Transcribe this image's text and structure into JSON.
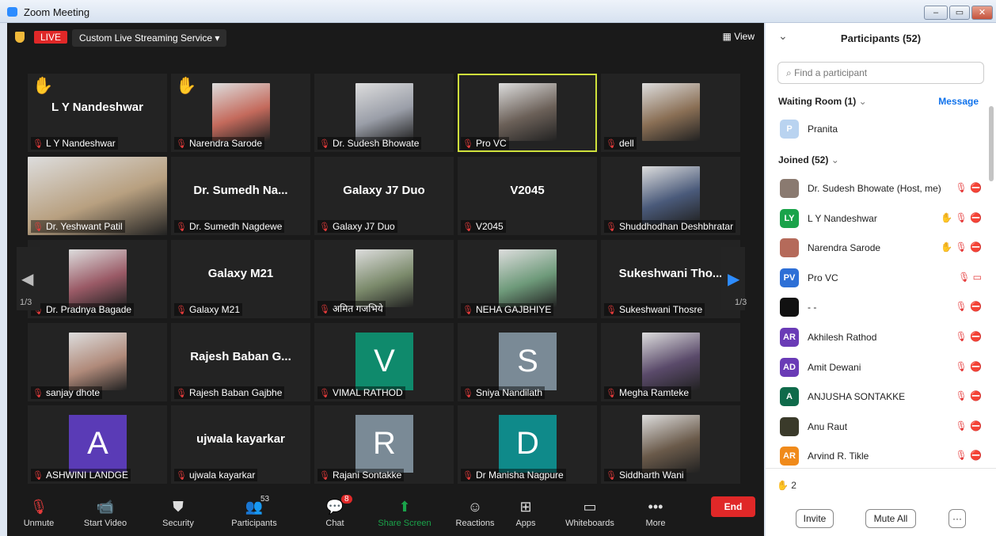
{
  "window": {
    "title": "Zoom Meeting",
    "min": "–",
    "restore": "▭",
    "close": "✕"
  },
  "topbar": {
    "live": "LIVE",
    "service": "Custom Live Streaming Service",
    "service_caret": "▾",
    "view": "View",
    "view_icon": "▦"
  },
  "tiles": [
    {
      "title": "L Y Nandeshwar",
      "label": "L Y Nandeshwar",
      "hand": "✋"
    },
    {
      "title": "",
      "label": "Narendra Sarode",
      "hand": "✋",
      "photo": "#c46a5c"
    },
    {
      "title": "",
      "label": "Dr. Sudesh Bhowate",
      "photo": "#9a9ea8"
    },
    {
      "title": "",
      "label": "Pro VC",
      "photo": "#6b6058",
      "speaking": true
    },
    {
      "title": "",
      "label": "dell",
      "photo": "#8a6f55"
    },
    {
      "title": "",
      "label": "Dr. Yeshwant Patil",
      "photo": "#b8a080"
    },
    {
      "title": "Dr. Sumedh Na...",
      "label": "Dr. Sumedh Nagdewe"
    },
    {
      "title": "Galaxy J7 Duo",
      "label": "Galaxy J7 Duo"
    },
    {
      "title": "V2045",
      "label": "V2045"
    },
    {
      "title": "",
      "label": "Shuddhodhan Deshbhratar",
      "photo": "#4a5a7a"
    },
    {
      "title": "",
      "label": "Dr. Pradnya Bagade",
      "photo": "#9a5a66"
    },
    {
      "title": "Galaxy M21",
      "label": "Galaxy M21"
    },
    {
      "title": "",
      "label": "अमित गजभिये",
      "photo": "#7b8a6b"
    },
    {
      "title": "",
      "label": "NEHA GAJBHIYE",
      "photo": "#6e9a7a"
    },
    {
      "title": "Sukeshwani Tho...",
      "label": "Sukeshwani Thosre"
    },
    {
      "title": "",
      "label": "sanjay dhote",
      "photo": "#b08a7a"
    },
    {
      "title": "Rajesh Baban G...",
      "label": "Rajesh Baban Gajbhe"
    },
    {
      "title": "",
      "label": "VIMAL RATHOD",
      "letter": "V",
      "color": "#0f8a6c"
    },
    {
      "title": "",
      "label": "Sniya Nandilath",
      "letter": "S",
      "color": "#7a8a96"
    },
    {
      "title": "",
      "label": "Megha Ramteke",
      "photo": "#5a4a6a"
    },
    {
      "title": "",
      "label": "ASHWINI LANDGE",
      "letter": "A",
      "color": "#5a3bb6"
    },
    {
      "title": "ujwala kayarkar",
      "label": "ujwala kayarkar"
    },
    {
      "title": "",
      "label": "Rajani Sontakke",
      "letter": "R",
      "color": "#7a8a96"
    },
    {
      "title": "",
      "label": "Dr Manisha Nagpure",
      "letter": "D",
      "color": "#0f8a8a"
    },
    {
      "title": "",
      "label": "Siddharth Wani",
      "photo": "#6a5a4a"
    }
  ],
  "nav": {
    "left": "◀",
    "right": "▶",
    "page_left": "1/3",
    "page_right": "1/3"
  },
  "toolbar": [
    {
      "name": "unmute",
      "icon": "🎙",
      "label": "Unmute"
    },
    {
      "name": "start-video",
      "icon": "📹",
      "label": "Start Video"
    },
    {
      "name": "security",
      "icon": "⛊",
      "label": "Security"
    },
    {
      "name": "participants",
      "icon": "👥",
      "label": "Participants",
      "badge": "53"
    },
    {
      "name": "chat",
      "icon": "💬",
      "label": "Chat",
      "badge": "8"
    },
    {
      "name": "share-screen",
      "icon": "⬆",
      "label": "Share Screen"
    },
    {
      "name": "reactions",
      "icon": "☺",
      "label": "Reactions"
    },
    {
      "name": "apps",
      "icon": "⊞",
      "label": "Apps"
    },
    {
      "name": "whiteboards",
      "icon": "▭",
      "label": "Whiteboards"
    },
    {
      "name": "more",
      "icon": "•••",
      "label": "More"
    }
  ],
  "end_label": "End",
  "panel": {
    "collapse": "⌄",
    "title": "Participants (52)",
    "search_placeholder": "Find a participant",
    "search_icon": "⌕",
    "waiting_room": "Waiting Room (1)",
    "message": "Message",
    "waiting": [
      {
        "name": "Pranita",
        "initials": "P",
        "color": "#b9d3f0"
      }
    ],
    "joined_label": "Joined (52)",
    "joined": [
      {
        "name": "Dr. Sudesh Bhowate (Host, me)",
        "initials": "",
        "color": "#8a7a70",
        "icons": "🎙 ⛔"
      },
      {
        "name": "L Y Nandeshwar",
        "initials": "LY",
        "color": "#1aa34a",
        "icons": "✋ 🎙 ⛔"
      },
      {
        "name": "Narendra Sarode",
        "initials": "",
        "color": "#b56a5a",
        "icons": "✋ 🎙 ⛔"
      },
      {
        "name": "Pro VC",
        "initials": "PV",
        "color": "#2d6fd6",
        "icons": "🎙 ▭"
      },
      {
        "name": "- -",
        "initials": "",
        "color": "#111111",
        "icons": "🎙 ⛔"
      },
      {
        "name": "Akhilesh Rathod",
        "initials": "AR",
        "color": "#6a3bb6",
        "icons": "🎙 ⛔"
      },
      {
        "name": "Amit Dewani",
        "initials": "AD",
        "color": "#6a3bb6",
        "icons": "🎙 ⛔"
      },
      {
        "name": "ANJUSHA SONTAKKE",
        "initials": "A",
        "color": "#0f6a4a",
        "icons": "🎙 ⛔"
      },
      {
        "name": "Anu Raut",
        "initials": "",
        "color": "#3a3a2a",
        "icons": "🎙 ⛔"
      },
      {
        "name": "Arvind R. Tikle",
        "initials": "AR",
        "color": "#f08a1a",
        "icons": "🎙 ⛔"
      }
    ],
    "hands": "2",
    "hand_icon": "✋",
    "invite": "Invite",
    "mute_all": "Mute All",
    "more": "···"
  }
}
